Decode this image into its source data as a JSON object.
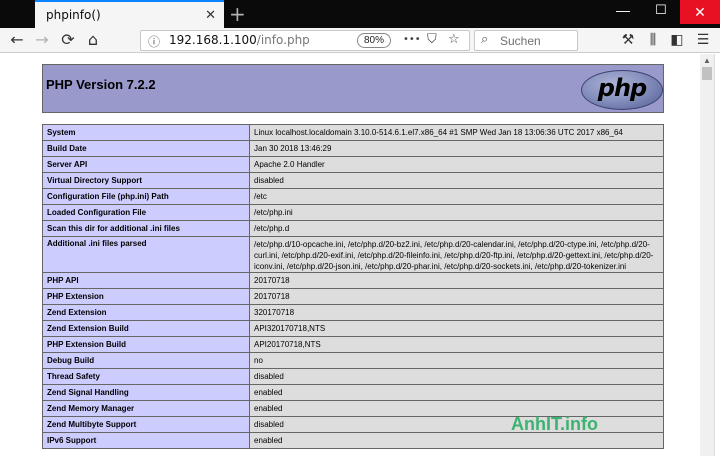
{
  "tab": {
    "title": "phpinfo()",
    "close": "✕",
    "new_tab": "+"
  },
  "window": {
    "minimize": "—",
    "maximize": "☐",
    "close": "✕"
  },
  "nav": {
    "back": "←",
    "forward": "→",
    "reload": "⟳",
    "home": "⌂",
    "url_host": "192.168.1.100",
    "url_path": "/info.php",
    "zoom": "80%",
    "more": "•••",
    "pocket": "⛉",
    "bookmark": "☆",
    "search_placeholder": "Suchen",
    "tools": "⚒",
    "library": "⫼",
    "sidebar": "◧",
    "menu": "☰"
  },
  "page": {
    "title": "PHP Version 7.2.2",
    "logo": "php",
    "rows": [
      {
        "label": "System",
        "value": "Linux localhost.localdomain 3.10.0-514.6.1.el7.x86_64 #1 SMP Wed Jan 18 13:06:36 UTC 2017 x86_64"
      },
      {
        "label": "Build Date",
        "value": "Jan 30 2018 13:46:29"
      },
      {
        "label": "Server API",
        "value": "Apache 2.0 Handler"
      },
      {
        "label": "Virtual Directory Support",
        "value": "disabled"
      },
      {
        "label": "Configuration File (php.ini) Path",
        "value": "/etc"
      },
      {
        "label": "Loaded Configuration File",
        "value": "/etc/php.ini"
      },
      {
        "label": "Scan this dir for additional .ini files",
        "value": "/etc/php.d"
      },
      {
        "label": "Additional .ini files parsed",
        "value_lines": [
          "/etc/php.d/10-opcache.ini, /etc/php.d/20-bz2.ini, /etc/php.d/20-calendar.ini, /etc/php.d/20-ctype.ini, /etc/php.d/20-",
          "curl.ini, /etc/php.d/20-exif.ini, /etc/php.d/20-fileinfo.ini, /etc/php.d/20-ftp.ini, /etc/php.d/20-gettext.ini, /etc/php.d/20-",
          "iconv.ini, /etc/php.d/20-json.ini, /etc/php.d/20-phar.ini, /etc/php.d/20-sockets.ini, /etc/php.d/20-tokenizer.ini"
        ]
      },
      {
        "label": "PHP API",
        "value": "20170718"
      },
      {
        "label": "PHP Extension",
        "value": "20170718"
      },
      {
        "label": "Zend Extension",
        "value": "320170718"
      },
      {
        "label": "Zend Extension Build",
        "value": "API320170718,NTS"
      },
      {
        "label": "PHP Extension Build",
        "value": "API20170718,NTS"
      },
      {
        "label": "Debug Build",
        "value": "no"
      },
      {
        "label": "Thread Safety",
        "value": "disabled"
      },
      {
        "label": "Zend Signal Handling",
        "value": "enabled"
      },
      {
        "label": "Zend Memory Manager",
        "value": "enabled"
      },
      {
        "label": "Zend Multibyte Support",
        "value": "disabled"
      },
      {
        "label": "IPv6 Support",
        "value": "enabled"
      }
    ]
  },
  "watermark": "AnhIT.info",
  "colors": {
    "header": "#9999cc",
    "label_cell": "#ccccff",
    "value_cell": "#dddddd",
    "accent": "#0a84ff",
    "close_red": "#e81123"
  }
}
